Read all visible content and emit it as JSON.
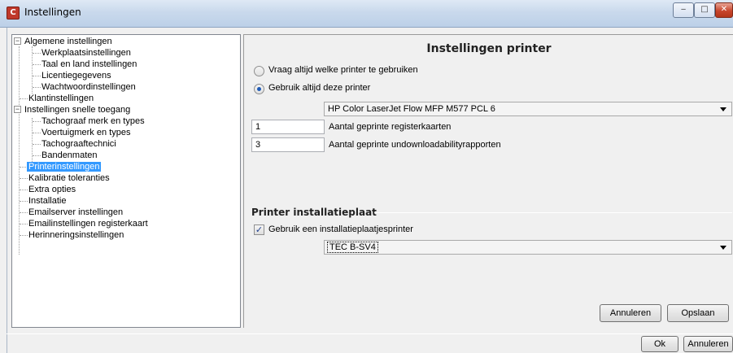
{
  "window": {
    "title": "Instellingen",
    "icon": "app-logo-icon",
    "controls": {
      "minimize": "‒",
      "maximize": "□",
      "close": "✕"
    }
  },
  "tree": {
    "items": [
      {
        "label": "Algemene instellingen",
        "expander": "−"
      },
      {
        "label": "Werkplaatsinstellingen"
      },
      {
        "label": "Taal en land instellingen"
      },
      {
        "label": "Licentiegegevens"
      },
      {
        "label": "Wachtwoordinstellingen"
      },
      {
        "label": "Klantinstellingen"
      },
      {
        "label": "Instellingen snelle toegang",
        "expander": "−"
      },
      {
        "label": "Tachograaf merk en types"
      },
      {
        "label": "Voertuigmerk en types"
      },
      {
        "label": "Tachograaftechnici"
      },
      {
        "label": "Bandenmaten"
      },
      {
        "label": "Printerinstellingen",
        "selected": true
      },
      {
        "label": "Kalibratie toleranties"
      },
      {
        "label": "Extra opties"
      },
      {
        "label": "Installatie"
      },
      {
        "label": "Emailserver instellingen"
      },
      {
        "label": "Emailinstellingen registerkaart"
      },
      {
        "label": "Herinneringsinstellingen"
      }
    ]
  },
  "panel": {
    "title": "Instellingen printer",
    "radio_ask": "Vraag altijd welke printer te gebruiken",
    "radio_always": "Gebruik altijd deze printer",
    "printer_select": "HP Color LaserJet Flow MFP M577 PCL 6",
    "registerkaarten_count": "1",
    "registerkaarten_label": "Aantal geprinte registerkaarten",
    "undownload_count": "3",
    "undownload_label": "Aantal geprinte undownloadabilityrapporten",
    "section_title": "Printer installatieplaat",
    "checkbox_label": "Gebruik een installatieplaatjesprinter",
    "plate_printer_select": "TEC B-SV4",
    "cancel": "Annuleren",
    "save": "Opslaan"
  },
  "footer": {
    "ok": "Ok",
    "cancel": "Annuleren"
  },
  "colors": {
    "selection": "#3399ff",
    "close_button": "#c8452c"
  }
}
